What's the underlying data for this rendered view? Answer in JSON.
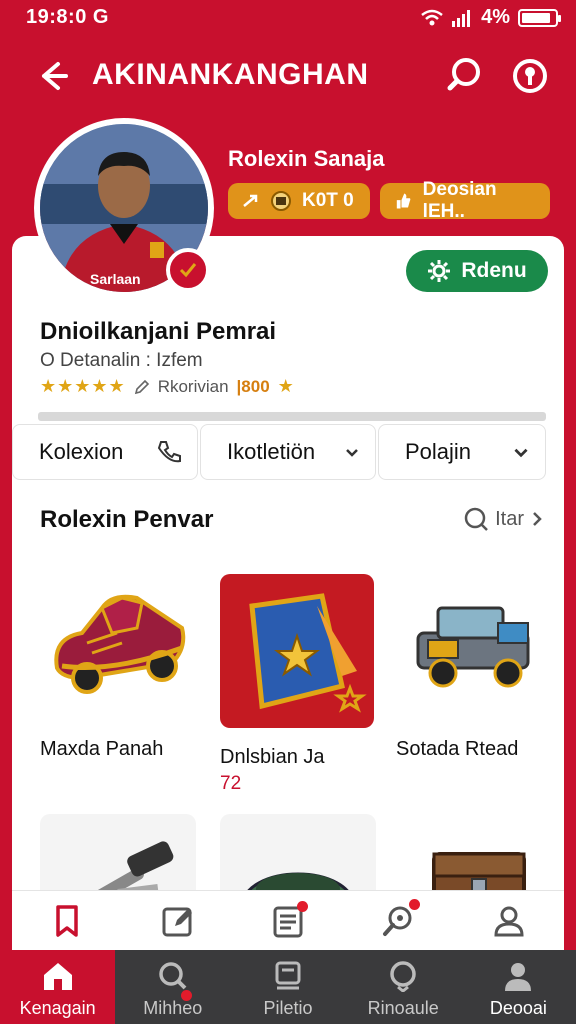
{
  "status": {
    "time": "19:8:0 G",
    "battery": "4%",
    "battery_level": 0.9
  },
  "appbar": {
    "title": "AKINANKANGHAN",
    "back_icon": "back-arrow-icon",
    "search_icon": "search-icon",
    "more_icon": "info-icon"
  },
  "profile": {
    "username": "Rolexin Sanaja",
    "chips": [
      {
        "icon": "arrow-icon",
        "coin_icon": "coin-icon",
        "label": "K0T 0"
      },
      {
        "icon": "thumb-icon",
        "label": "Deosian lEH.."
      }
    ],
    "follow_button": "Rdenu",
    "full_name": "Dnioilkanjani Pemrai",
    "meta": "O Detanalin : Izfem",
    "rating": {
      "stars": "★★★★★",
      "label": "Rkorivian",
      "points": "|800"
    }
  },
  "tabs": [
    {
      "label": "Kolexion",
      "icon": "phone-icon"
    },
    {
      "label": "Ikotletiön",
      "icon": "chevron-down-icon"
    },
    {
      "label": "Polajin",
      "icon": "chevron-down-icon"
    }
  ],
  "section": {
    "title": "Rolexin Penvar",
    "link": "Itar"
  },
  "items": [
    {
      "label": "Maxda Panah",
      "price": "",
      "icon": "shoe-car-icon"
    },
    {
      "label": "Dnlsbian Ja",
      "price": "72",
      "icon": "flag-cape-icon"
    },
    {
      "label": "Sotada Rtead",
      "price": "",
      "icon": "armored-truck-icon"
    }
  ],
  "row2": [
    {
      "icon": "hammer-icon"
    },
    {
      "icon": "bathtub-icon"
    },
    {
      "icon": "chest-icon"
    }
  ],
  "toolbar": [
    {
      "icon": "bookmark-icon",
      "dot": false
    },
    {
      "icon": "edit-icon",
      "dot": false
    },
    {
      "icon": "list-icon",
      "dot": true
    },
    {
      "icon": "search-badge-icon",
      "dot": true
    },
    {
      "icon": "user-icon",
      "dot": false
    }
  ],
  "nav": [
    {
      "label": "Kenagain",
      "icon": "home-icon",
      "active": true
    },
    {
      "label": "Mihheo",
      "icon": "search-icon",
      "dot": true
    },
    {
      "label": "Piletio",
      "icon": "chat-icon"
    },
    {
      "label": "Rinoaule",
      "icon": "heart-icon"
    },
    {
      "label": "Deooai",
      "icon": "profile-icon"
    }
  ],
  "colors": {
    "primary": "#c8102e",
    "follow": "#1a8a4a",
    "chip": "#e0931a",
    "nav_bg": "#3a3a3c"
  }
}
